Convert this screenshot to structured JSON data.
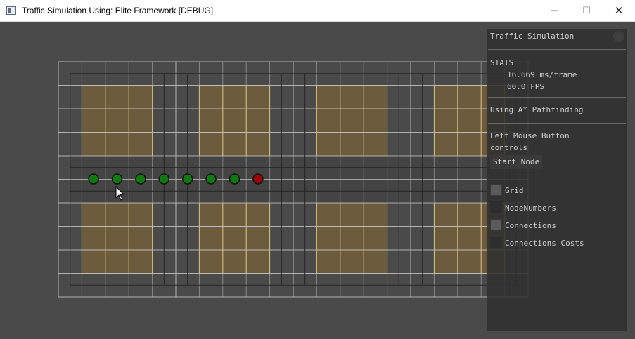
{
  "window": {
    "title": "Traffic Simulation Using: Elite Framework [DEBUG]",
    "icon": "app-window-icon",
    "buttons": {
      "minimize": "─",
      "maximize": "☐",
      "close": "✕"
    }
  },
  "colors": {
    "background": "#4a4a4a",
    "grid_line": "#bdbdbd",
    "road_line": "#262626",
    "block_fill": "#6d5b3e",
    "block_edge": "#e7b74a",
    "node_green": "#0f7a0f",
    "node_red": "#a00000"
  },
  "scene": {
    "grid": {
      "columns": 20,
      "rows": 10
    },
    "blocks": [
      {
        "col": 1,
        "row": 1,
        "cols": 3,
        "rows": 3
      },
      {
        "col": 6,
        "row": 1,
        "cols": 3,
        "rows": 3
      },
      {
        "col": 11,
        "row": 1,
        "cols": 3,
        "rows": 3
      },
      {
        "col": 16,
        "row": 1,
        "cols": 3,
        "rows": 3
      },
      {
        "col": 1,
        "row": 6,
        "cols": 3,
        "rows": 3
      },
      {
        "col": 6,
        "row": 6,
        "cols": 3,
        "rows": 3
      },
      {
        "col": 11,
        "row": 6,
        "cols": 3,
        "rows": 3
      },
      {
        "col": 16,
        "row": 6,
        "cols": 3,
        "rows": 3
      }
    ],
    "path_nodes": [
      {
        "col": 1,
        "row": 5,
        "state": "green"
      },
      {
        "col": 2,
        "row": 5,
        "state": "green"
      },
      {
        "col": 3,
        "row": 5,
        "state": "green"
      },
      {
        "col": 4,
        "row": 5,
        "state": "green"
      },
      {
        "col": 5,
        "row": 5,
        "state": "green"
      },
      {
        "col": 6,
        "row": 5,
        "state": "green"
      },
      {
        "col": 7,
        "row": 5,
        "state": "green"
      },
      {
        "col": 8,
        "row": 5,
        "state": "red"
      }
    ]
  },
  "panel": {
    "title": "Traffic Simulation",
    "stats_header": "STATS",
    "ms_per_frame": "16.669 ms/frame",
    "fps": "60.0 FPS",
    "algorithm": "Using A* Pathfinding",
    "controls_line1": "Left Mouse Button",
    "controls_line2": "controls",
    "start_node_button": "Start Node",
    "toggles": [
      {
        "label": "Grid",
        "checked": true
      },
      {
        "label": "NodeNumbers",
        "checked": false
      },
      {
        "label": "Connections",
        "checked": true
      },
      {
        "label": "Connections Costs",
        "checked": false
      }
    ]
  }
}
